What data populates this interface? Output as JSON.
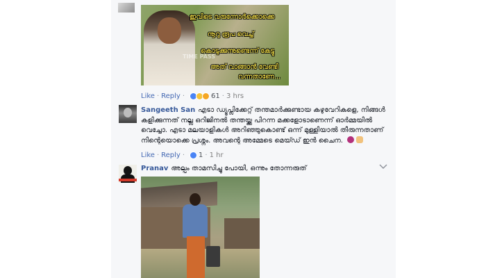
{
  "post1": {
    "caption_lines": [
      "ഇവിടെ വരുന്നോർക്കൊക്കെ",
      "നൂറു രൂപ വെച്ച്",
      "കൊടുക്കുന്നുണ്ടെന്ന് കേട്ടു",
      "അത് വാങ്ങാൻ വേണ്ടി",
      "വന്നതാണേ..."
    ],
    "watermark": "TIME PASS"
  },
  "actions1": {
    "like": "Like",
    "reply": "Reply",
    "reaction_count": "61",
    "time": "3 hrs"
  },
  "comment_sangeeth": {
    "author": "Sangeeth San",
    "text": "എടാ ഡ്യൂപ്ലിക്കേറ്റ് തന്തമാർക്കുണ്ടായ കഴുവേറികളെ, നിങ്ങൾ കളിക്കുന്നത് നല്ല ഒറിജിനൽ തന്തയ്ക്കു പിറന്ന മക്കളോടാണെന്ന് ഓർമ്മയിൽ വെച്ചോ. എടാ മലയാളികൾ അറിഞ്ഞുകൊണ്ട് ഒന്ന് മുള്ളിയാൽ തീരുന്നതാണ് നിന്റെയൊക്കെ പ്രശ്നം. അവന്റെ അമ്മേടെ മെയ്ഡ് ഇൻ ചൈന."
  },
  "actions2": {
    "like": "Like",
    "reply": "Reply",
    "reaction_count": "1",
    "time": "1 hr"
  },
  "comment_pranav": {
    "author": "Pranav",
    "text": "അല്പം താമസിച്ചു പോയി, ഒന്നും തോന്നരുത്"
  },
  "icons": {
    "options": "chevron-down-icon",
    "like_reaction": "like-reaction-icon",
    "haha_reaction": "haha-reaction-icon",
    "wow_reaction": "wow-reaction-icon",
    "devil_emoji": "devil-emoji-icon",
    "finger_emoji": "middle-finger-emoji-icon"
  },
  "colors": {
    "link": "#4267b2",
    "author": "#365899",
    "panel": "#f6f7f9"
  }
}
